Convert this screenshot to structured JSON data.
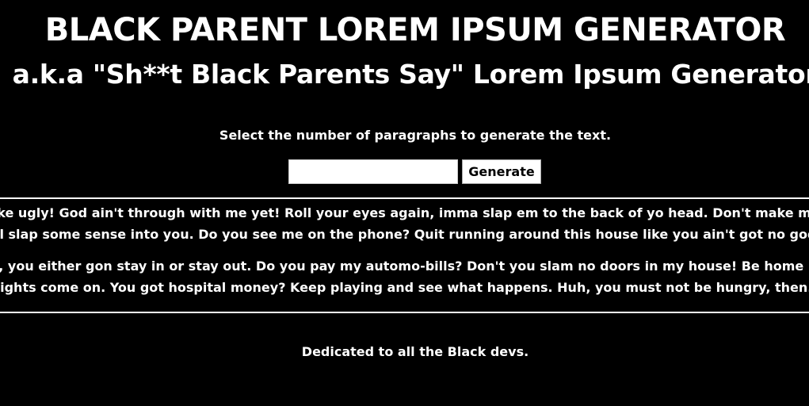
{
  "header": {
    "title": "BLACK PARENT LOREM IPSUM GENERATOR",
    "subtitle": "a.k.a \"Sh**t Black Parents Say\" Lorem Ipsum Generator"
  },
  "form": {
    "instructions": "Select the number of paragraphs to generate the text.",
    "input_value": "",
    "button_label": "Generate"
  },
  "output": {
    "paragraphs": [
      {
        "lines": [
          "like ugly! God ain't through with me yet! Roll your eyes again, imma slap em to the back of yo head. Don't make me",
          "vill slap some sense into you. Do you see me on the phone? Quit running around this house like you ain't got no godd"
        ]
      },
      {
        "lines": [
          "se, you either gon stay in or stay out. Do you pay my automo-bills? Don't you slam no doors in my house! Be home be",
          "lights come on. You got hospital money? Keep playing and see what happens. Huh, you must not be hungry, then."
        ]
      }
    ]
  },
  "footer": {
    "dedication": "Dedicated to all the Black devs."
  },
  "colors": {
    "background": "#000000",
    "text": "#ffffff"
  }
}
